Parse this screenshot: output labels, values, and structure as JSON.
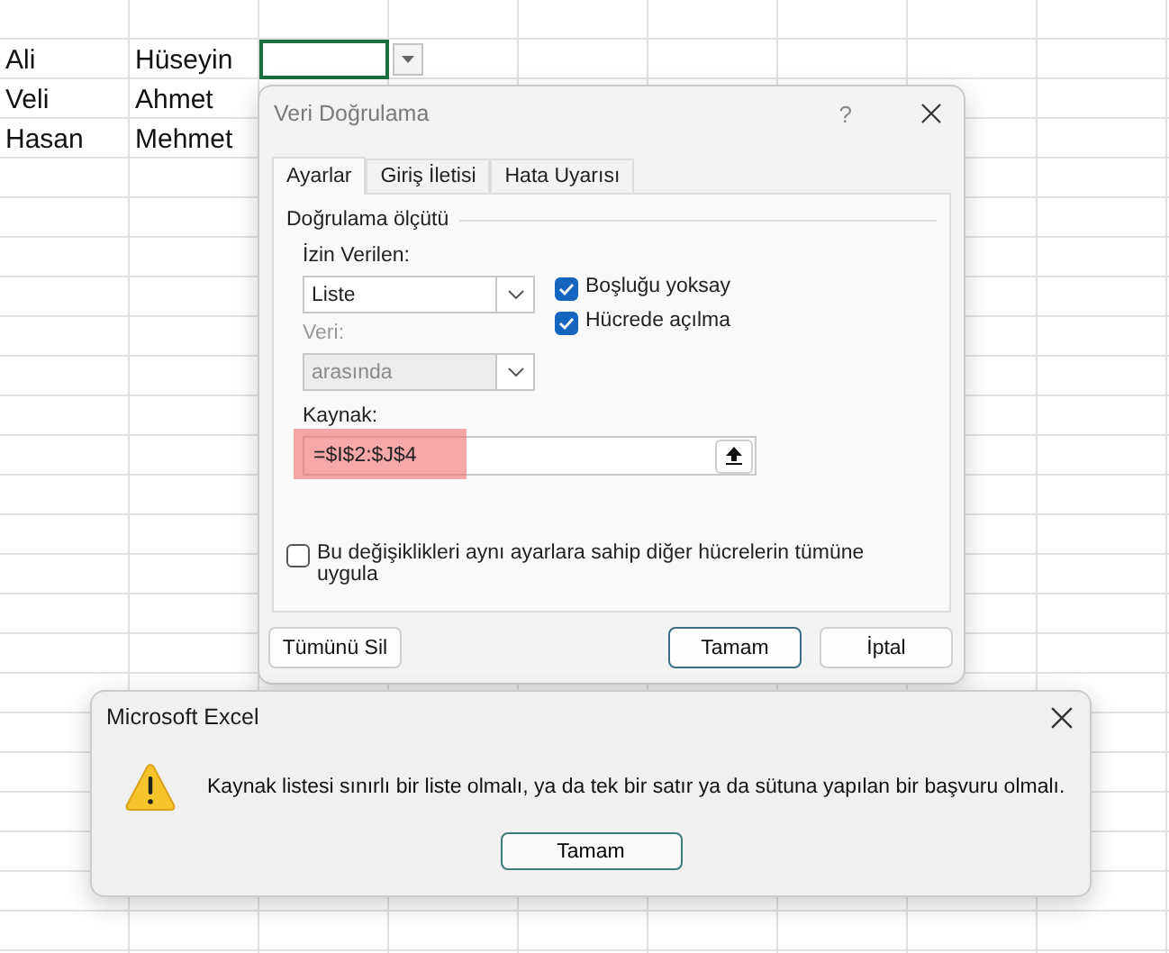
{
  "sheet": {
    "rows": [
      {
        "values": [
          "Ali",
          "Hüseyin"
        ],
        "selected": true
      },
      {
        "values": [
          "Veli",
          "Ahmet"
        ],
        "selected": false
      },
      {
        "values": [
          "Hasan",
          "Mehmet"
        ],
        "selected": false
      }
    ]
  },
  "dialog": {
    "title": "Veri Doğrulama",
    "help": "?",
    "tabs": [
      {
        "label": "Ayarlar",
        "selected": true
      },
      {
        "label": "Giriş İletisi",
        "selected": false
      },
      {
        "label": "Hata Uyarısı",
        "selected": false
      }
    ],
    "group_title": "Doğrulama ölçütü",
    "allow": {
      "label": "İzin Verilen:",
      "value": "Liste",
      "disabled": false
    },
    "data": {
      "label": "Veri:",
      "value": "arasında",
      "disabled": true
    },
    "options": [
      {
        "label": "Boşluğu yoksay",
        "checked": true
      },
      {
        "label": "Hücrede açılma",
        "checked": true
      }
    ],
    "source": {
      "label": "Kaynak:",
      "value": "=$I$2:$J$4",
      "highlighted": true
    },
    "apply_all": {
      "label": "Bu değişiklikleri aynı ayarlara sahip diğer hücrelerin tümüne uygula",
      "checked": false
    },
    "buttons": [
      {
        "label": "Tümünü Sil",
        "kind": "left"
      },
      {
        "label": "Tamam",
        "kind": "default"
      },
      {
        "label": "İptal",
        "kind": "normal"
      }
    ]
  },
  "alert": {
    "title": "Microsoft Excel",
    "message": "Kaynak listesi sınırlı bir liste olmalı, ya da tek bir satır ya da sütuna yapılan bir başvuru olmalı.",
    "button": "Tamam"
  }
}
